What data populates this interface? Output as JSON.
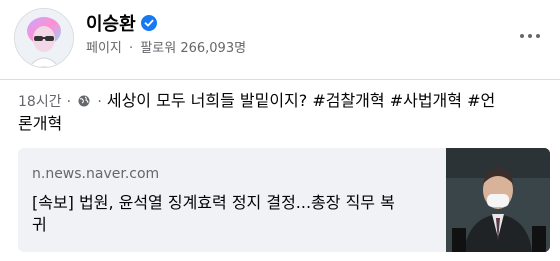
{
  "profile": {
    "name": "이승환",
    "meta_type": "페이지",
    "meta_separator": "·",
    "followers_label": "팔로워",
    "followers_count": "266,093명"
  },
  "post": {
    "time": "18시간",
    "dot": "·",
    "text_line1": "세상이 모두 너희들 발밑이지? #검찰개혁 #사법개혁 #언",
    "text_line2": "론개혁"
  },
  "link": {
    "domain": "n.news.naver.com",
    "title_line1": "[속보] 법원, 윤석열 징계효력 정지 결정...총장 직무 복",
    "title_line2": "귀"
  },
  "icons": {
    "verified": "verified-badge-icon",
    "globe": "globe-icon",
    "more": "more-options-icon"
  },
  "colors": {
    "verified_blue": "#1877f2",
    "secondary_text": "#65676b",
    "card_bg": "#f0f2f5"
  }
}
